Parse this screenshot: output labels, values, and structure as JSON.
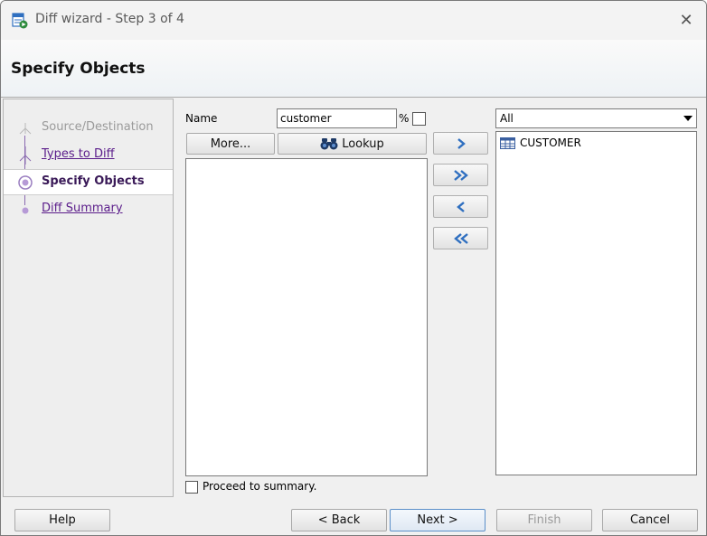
{
  "window": {
    "title": "Diff wizard - Step 3 of 4",
    "close_glyph": "✕"
  },
  "header": {
    "title": "Specify Objects"
  },
  "steps": [
    {
      "label": "Source/Destination",
      "state": "disabled"
    },
    {
      "label": "Types to Diff",
      "state": "link"
    },
    {
      "label": "Specify Objects",
      "state": "current"
    },
    {
      "label": "Diff Summary",
      "state": "link"
    }
  ],
  "filter": {
    "name_label": "Name",
    "name_value": "customer",
    "wildcard_label": "%",
    "wildcard_checked": false
  },
  "buttons": {
    "more": "More...",
    "lookup": "Lookup",
    "help": "Help",
    "back": "< Back",
    "next": "Next >",
    "finish": "Finish",
    "cancel": "Cancel"
  },
  "move_buttons": [
    {
      "name": "move-right-button",
      "icon": "single-right-arrow-icon"
    },
    {
      "name": "move-all-right-button",
      "icon": "double-right-arrow-icon"
    },
    {
      "name": "move-left-button",
      "icon": "single-left-arrow-icon"
    },
    {
      "name": "move-all-left-button",
      "icon": "double-left-arrow-icon"
    }
  ],
  "available_list": {
    "items": []
  },
  "selected_type_filter": {
    "value": "All"
  },
  "selected_list": {
    "items": [
      {
        "label": "CUSTOMER",
        "icon": "table-icon"
      }
    ]
  },
  "proceed": {
    "label": "Proceed to summary.",
    "checked": false
  },
  "colors": {
    "accent": "#5a1c8a",
    "arrow": "#2f6fc0",
    "default_border": "#5b8fc9"
  }
}
